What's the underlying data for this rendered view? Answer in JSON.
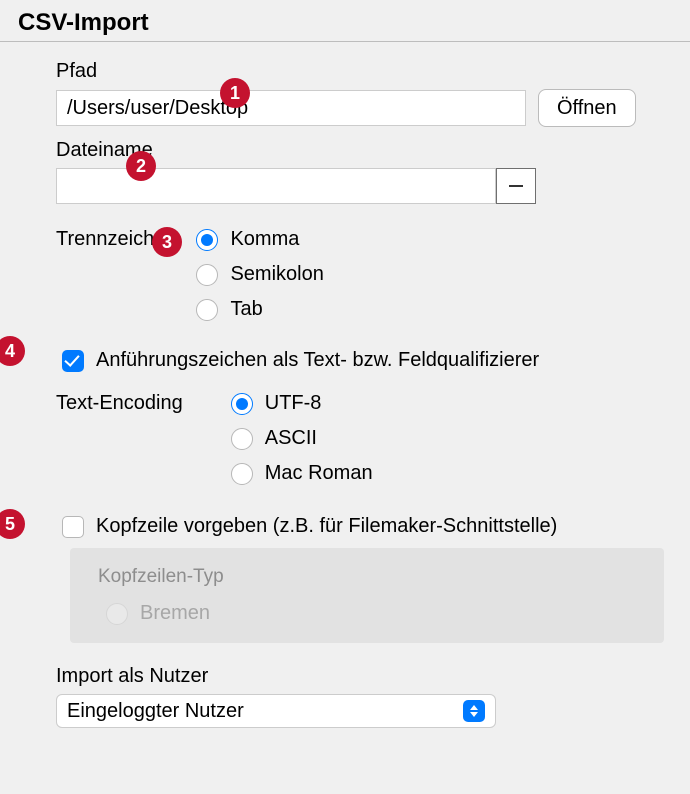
{
  "title": "CSV-Import",
  "path": {
    "label": "Pfad",
    "value": "/Users/user/Desktop",
    "open_button": "Öffnen"
  },
  "filename": {
    "label": "Dateiname",
    "value": ""
  },
  "separator": {
    "label": "Trennzeichen",
    "options": [
      {
        "label": "Komma",
        "checked": true
      },
      {
        "label": "Semikolon",
        "checked": false
      },
      {
        "label": "Tab",
        "checked": false
      }
    ]
  },
  "quotes": {
    "label": "Anführungszeichen als Text- bzw. Feldqualifizierer",
    "checked": true
  },
  "encoding": {
    "label": "Text-Encoding",
    "options": [
      {
        "label": "UTF-8",
        "checked": true
      },
      {
        "label": "ASCII",
        "checked": false
      },
      {
        "label": "Mac Roman",
        "checked": false
      }
    ]
  },
  "header": {
    "label": "Kopfzeile vorgeben (z.B. für Filemaker-Schnittstelle)",
    "checked": false,
    "type_label": "Kopfzeilen-Typ",
    "options": [
      {
        "label": "Bremen",
        "checked": false
      }
    ]
  },
  "import_as": {
    "label": "Import als Nutzer",
    "value": "Eingeloggter Nutzer"
  },
  "badges": [
    "1",
    "2",
    "3",
    "4",
    "5"
  ]
}
